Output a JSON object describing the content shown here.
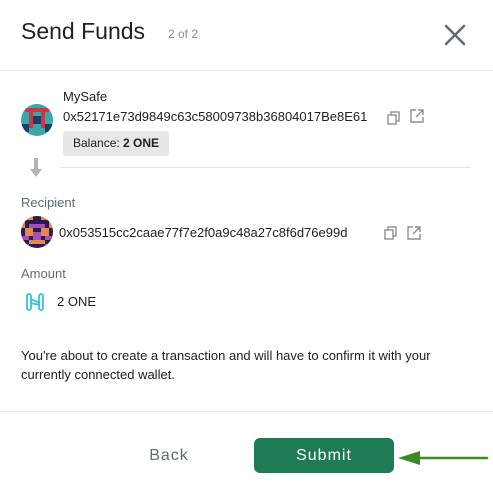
{
  "header": {
    "title": "Send Funds",
    "step": "2 of 2"
  },
  "sender": {
    "name": "MySafe",
    "address": "0x52171e73d9849c63c58009738b36804017Be8E61",
    "balance_label": "Balance:",
    "balance_value": "2 ONE"
  },
  "recipient": {
    "label": "Recipient",
    "address": "0x053515cc2caae77f7e2f0a9c48a27c8f6d76e99d"
  },
  "amount": {
    "label": "Amount",
    "value": "2 ONE"
  },
  "note": "You're about to create a transaction and will have to confirm it with your currently connected wallet.",
  "buttons": {
    "back": "Back",
    "submit": "Submit"
  },
  "colors": {
    "submit": "#1f7a55",
    "arrow": "#3c8a22",
    "token": "#35c5d5"
  },
  "icons": [
    "close-icon",
    "copy-icon",
    "external-link-icon",
    "down-arrow-icon",
    "one-token-icon"
  ]
}
